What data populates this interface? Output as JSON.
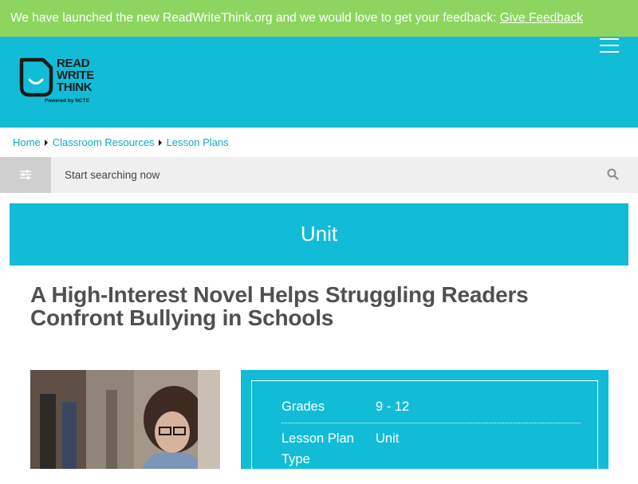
{
  "banner": {
    "text": "We have launched the new ReadWriteThink.org and we would love to get your feedback: ",
    "link": "Give Feedback"
  },
  "header": {
    "logo_lines": [
      "READ",
      "WRITE",
      "THINK"
    ],
    "logo_sub": "Powered by NCTE",
    "menu_icon": "hamburger-icon"
  },
  "breadcrumb": [
    "Home",
    "Classroom Resources",
    "Lesson Plans"
  ],
  "search": {
    "placeholder": "Start searching now",
    "filter_icon": "sliders-icon",
    "search_icon": "search-icon"
  },
  "unit_label": "Unit",
  "title": "A High-Interest Novel Helps Struggling Readers Confront Bullying in Schools",
  "details": [
    {
      "key": "Grades",
      "value": "9 - 12"
    },
    {
      "key": "Lesson Plan Type",
      "value": "Unit"
    }
  ],
  "colors": {
    "banner": "#8dd55f",
    "brand": "#12bcd7",
    "link": "#12a7c4",
    "title": "#505050"
  }
}
